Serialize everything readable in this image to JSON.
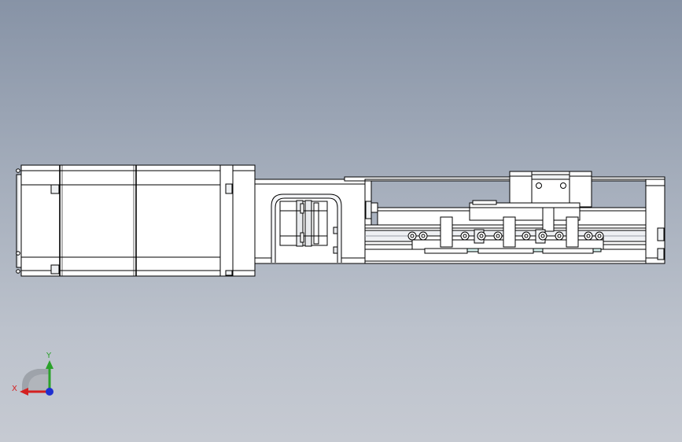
{
  "viewport": {
    "background_top": "#8793a6",
    "background_bottom": "#c6cad2",
    "model_fill": "#ffffff",
    "model_shade": "#e6e8ec",
    "model_stroke": "#000000"
  },
  "triad": {
    "x_label": "X",
    "y_label": "Y",
    "x_color": "#d42020",
    "y_color": "#2aa12a",
    "z_color": "#1f2fd0",
    "icon": "coordinate-triad-icon"
  }
}
